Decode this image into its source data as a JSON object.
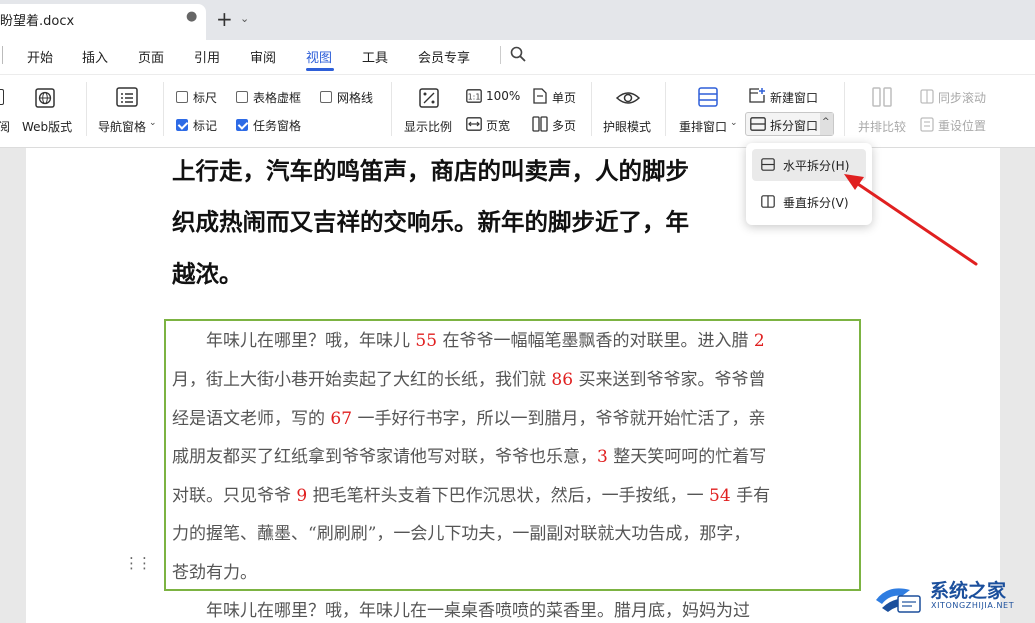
{
  "tab": {
    "title": "盼望着.docx",
    "dot": "●",
    "new_tab": "+",
    "menu": "⌄"
  },
  "menu": {
    "items": [
      "开始",
      "插入",
      "页面",
      "引用",
      "审阅",
      "视图",
      "工具",
      "会员专享"
    ],
    "active": "视图"
  },
  "ribbon": {
    "web_partial": "阅",
    "web_layout": "Web版式",
    "nav_pane": "导航窗格",
    "ruler": "标尺",
    "table_gridlines": "表格虚框",
    "gridlines": "网格线",
    "marks": "标记",
    "task_pane": "任务窗格",
    "zoom": "显示比例",
    "zoom_100": "100%",
    "page_width": "页宽",
    "single_page": "单页",
    "multi_page": "多页",
    "eye_mode": "护眼模式",
    "rearrange": "重排窗口",
    "new_window": "新建窗口",
    "split_window": "拆分窗口",
    "side_by_side": "并排比较",
    "sync_scroll": "同步滚动",
    "reset_position": "重设位置",
    "checked": {
      "ruler": false,
      "table_gridlines": false,
      "gridlines": false,
      "marks": true,
      "task_pane": true
    }
  },
  "dropdown": {
    "items": [
      "水平拆分(H)",
      "垂直拆分(V)"
    ]
  },
  "document": {
    "heading_lines": [
      "上行走，汽车的鸣笛声，商店的叫卖声，人的脚步",
      "织成热闹而又吉祥的交响乐。新年的脚步近了，年",
      "越浓。"
    ],
    "para_lines": [
      [
        "　　年味儿在哪里？哦，年味儿 ",
        "55",
        " 在爷爷一幅幅笔墨飘香的对联里。进入腊 ",
        "2"
      ],
      [
        "月，街上大街小巷开始卖起了大红的长纸，我们就 ",
        "86",
        " 买来送到爷爷家。爷爷曾",
        ""
      ],
      [
        "经是语文老师，写的 ",
        "67",
        " 一手好行书字，所以一到腊月，爷爷就开始忙活了，亲",
        ""
      ],
      [
        "戚朋友都买了红纸拿到爷爷家请他写对联，爷爷也乐意，",
        "3",
        " 整天笑呵呵的忙着写",
        ""
      ],
      [
        "对联。只见爷爷 ",
        "9",
        " 把毛笔杆头支着下巴作沉思状，然后，一手按纸，一 ",
        "54",
        " 手有"
      ],
      [
        "力的握笔、蘸墨、“刷刷刷”，一会儿下功夫，一副副对联就大功告成，那字，",
        ""
      ],
      [
        "苍劲有力。",
        ""
      ]
    ],
    "next_line": "　　年味儿在哪里？哦，年味儿在一桌桌香喷喷的菜香里。腊月底，妈妈为过"
  },
  "watermark": {
    "title": "系统之家",
    "url": "XITONGZHIJIA.NET"
  },
  "colors": {
    "accent": "#2e5fd8",
    "highlight_border": "#7cb342",
    "red_numbers": "#e02020",
    "arrow": "#e02020"
  }
}
